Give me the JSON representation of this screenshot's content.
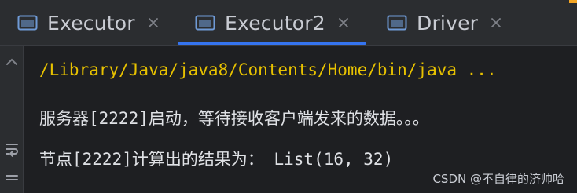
{
  "tabs": [
    {
      "label": "Executor",
      "active": false
    },
    {
      "label": "Executor2",
      "active": true
    },
    {
      "label": "Driver",
      "active": false
    }
  ],
  "console": {
    "lines": [
      "/Library/Java/java8/Contents/Home/bin/java ...",
      "服务器[2222]启动，等待接收客户端发来的数据。。。",
      "节点[2222]计算出的结果为：  List(16, 32)"
    ]
  },
  "watermark": "CSDN @不自律的济帅哈",
  "colors": {
    "accent": "#3574f0",
    "command_text": "#e8c200",
    "output_text": "#dfe1e5",
    "background": "#1e1f22"
  },
  "icons": {
    "tab": "console-window-icon",
    "close": "close-icon",
    "gutter_up": "chevron-up-icon",
    "gutter_wrap": "soft-wrap-icon"
  }
}
